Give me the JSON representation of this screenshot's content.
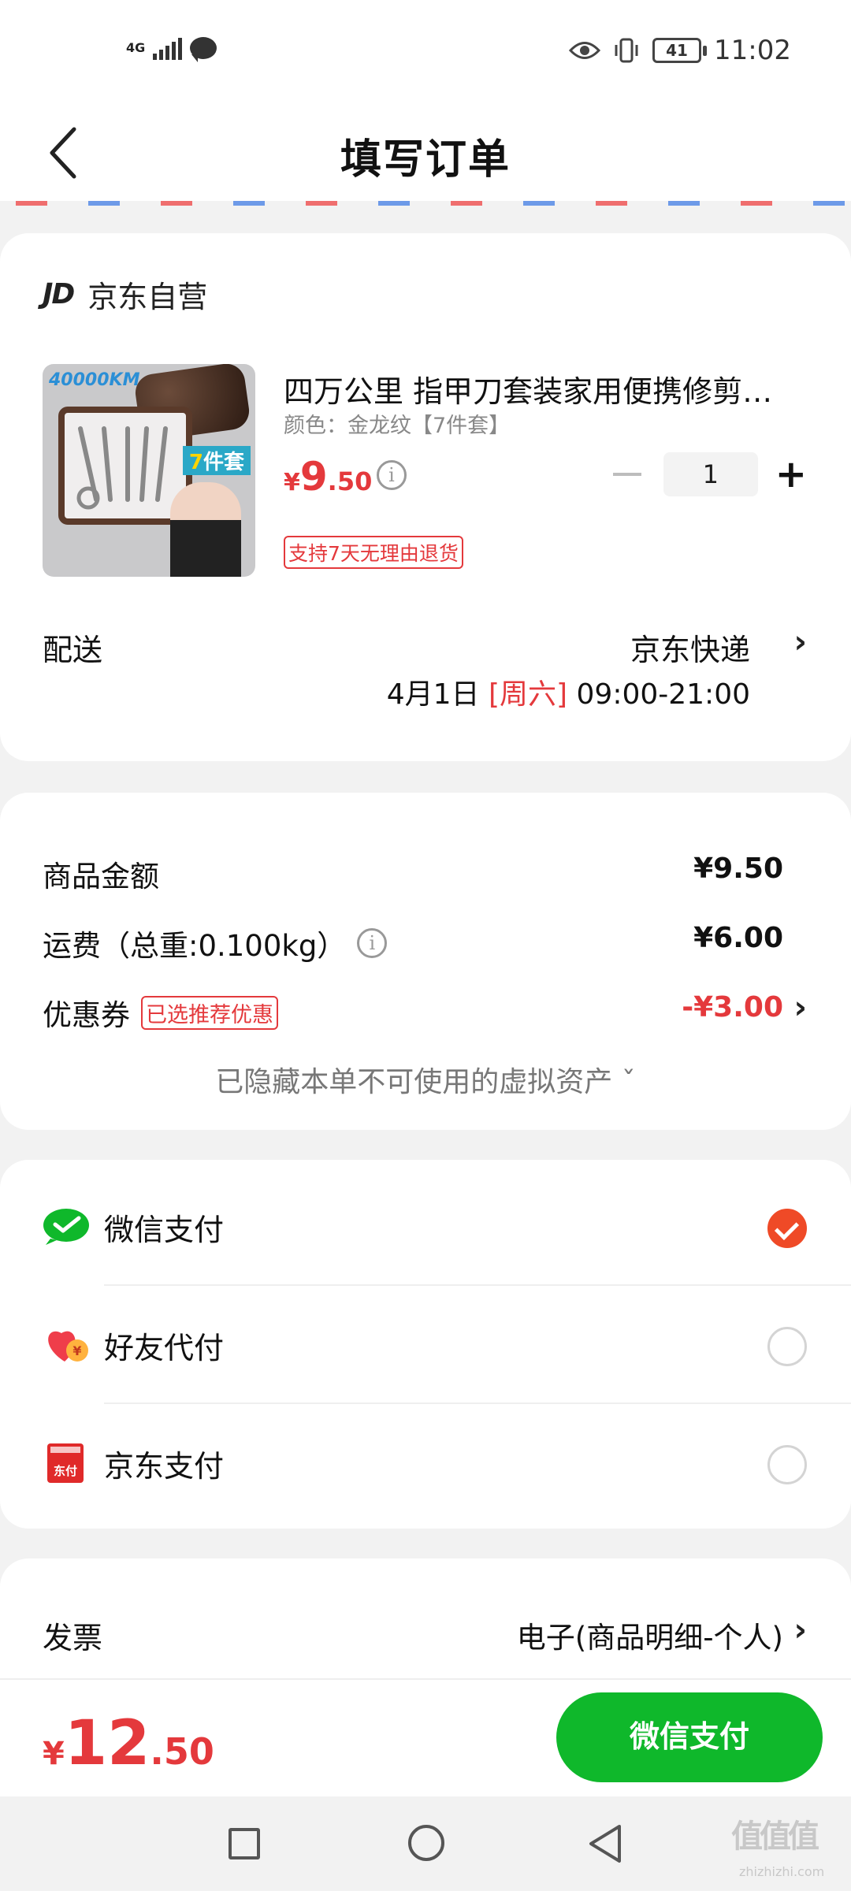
{
  "status_bar": {
    "network": "4G",
    "battery": "41",
    "time": "11:02"
  },
  "header": {
    "title": "填写订单"
  },
  "shop": {
    "logo": "JD",
    "name": "京东自营"
  },
  "product": {
    "image_brand_text": "40000KM",
    "image_tag_num": "7",
    "image_tag_text": "件套",
    "title": "四万公里 指甲刀套装家用便携修剪…",
    "spec": "颜色：金龙纹【7件套】",
    "price_currency": "¥",
    "price_int": "9",
    "price_dec": ".50",
    "quantity": "1",
    "return_tag": "支持7天无理由退货"
  },
  "delivery": {
    "label": "配送",
    "carrier": "京东快递",
    "date": "4月1日",
    "weekday": "[周六]",
    "time_window": "09:00-21:00"
  },
  "summary": {
    "goods_label": "商品金额",
    "goods_value": "¥9.50",
    "shipping_label": "运费（总重:0.100kg）",
    "shipping_value": "¥6.00",
    "coupon_label": "优惠券",
    "coupon_tag": "已选推荐优惠",
    "coupon_value": "-¥3.00",
    "hidden_assets": "已隐藏本单不可使用的虚拟资产 ˇ"
  },
  "payment": {
    "options": [
      {
        "label": "微信支付",
        "icon": "wechat-pay-icon",
        "selected": true
      },
      {
        "label": "好友代付",
        "icon": "friend-pay-icon",
        "selected": false
      },
      {
        "label": "京东支付",
        "icon": "jd-pay-icon",
        "selected": false
      }
    ],
    "jd_icon_text": "东付"
  },
  "invoice": {
    "label": "发票",
    "value": "电子(商品明细-个人)"
  },
  "footer": {
    "total_currency": "¥",
    "total_int": "12",
    "total_dec": ".50",
    "pay_button": "微信支付"
  },
  "watermark": {
    "text": "值值值",
    "sub": "zhizhizhi.com"
  },
  "colors": {
    "accent_red": "#e4393c",
    "wechat_green": "#0fb82b",
    "radio_selected": "#ef4a27"
  }
}
